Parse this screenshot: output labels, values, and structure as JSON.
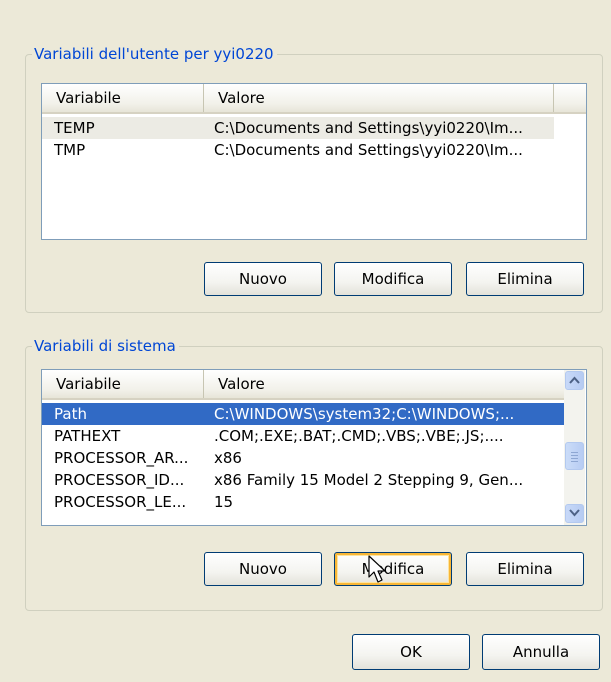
{
  "user_group": {
    "title": "Variabili dell'utente per yyi0220",
    "columns": [
      "Variabile",
      "Valore"
    ],
    "rows": [
      {
        "variable": "TEMP",
        "value": "C:\\Documents and Settings\\yyi0220\\Im..."
      },
      {
        "variable": "TMP",
        "value": "C:\\Documents and Settings\\yyi0220\\Im..."
      }
    ],
    "buttons": {
      "new": "Nuovo",
      "edit": "Modifica",
      "delete": "Elimina"
    }
  },
  "system_group": {
    "title": "Variabili di sistema",
    "columns": [
      "Variabile",
      "Valore"
    ],
    "rows": [
      {
        "variable": "Path",
        "value": "C:\\WINDOWS\\system32;C:\\WINDOWS;..."
      },
      {
        "variable": "PATHEXT",
        "value": ".COM;.EXE;.BAT;.CMD;.VBS;.VBE;.JS;...."
      },
      {
        "variable": "PROCESSOR_AR...",
        "value": "x86"
      },
      {
        "variable": "PROCESSOR_ID...",
        "value": "x86 Family 15 Model 2 Stepping 9, Gen..."
      },
      {
        "variable": "PROCESSOR_LE...",
        "value": "15"
      }
    ],
    "selected_row": "Path",
    "buttons": {
      "new": "Nuovo",
      "edit": "Modifica",
      "delete": "Elimina"
    }
  },
  "footer": {
    "ok": "OK",
    "cancel": "Annulla"
  },
  "icons": {
    "scroll_up": "scroll-up-arrow-icon",
    "scroll_down": "scroll-down-arrow-icon",
    "cursor": "mouse-pointer-icon"
  },
  "colors": {
    "legend_text": "#0046d5",
    "selection": "#316ac5",
    "dialog_bg": "#ece9d8",
    "button_hover": "#f8b636"
  }
}
